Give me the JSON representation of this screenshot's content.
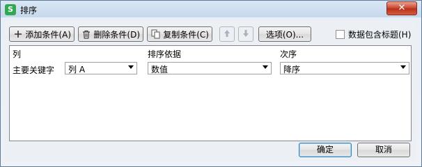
{
  "window": {
    "title": "排序",
    "app_icon_letter": "S",
    "close_glyph": "✕"
  },
  "toolbar": {
    "add_label": "添加条件(A)",
    "delete_label": "删除条件(D)",
    "copy_label": "复制条件(C)",
    "options_label": "选项(O)...",
    "header_checkbox_label": "数据包含标题(H)",
    "header_checkbox_checked": false
  },
  "grid": {
    "headers": {
      "column": "列",
      "sort_on": "排序依据",
      "order": "次序"
    },
    "rows": [
      {
        "label": "主要关键字",
        "column": "列 A",
        "sort_on": "数值",
        "order": "降序"
      }
    ]
  },
  "footer": {
    "ok_label": "确定",
    "cancel_label": "取消"
  },
  "colors": {
    "accent": "#3c7fb1",
    "close_red": "#c7422b",
    "app_green": "#33a852"
  }
}
